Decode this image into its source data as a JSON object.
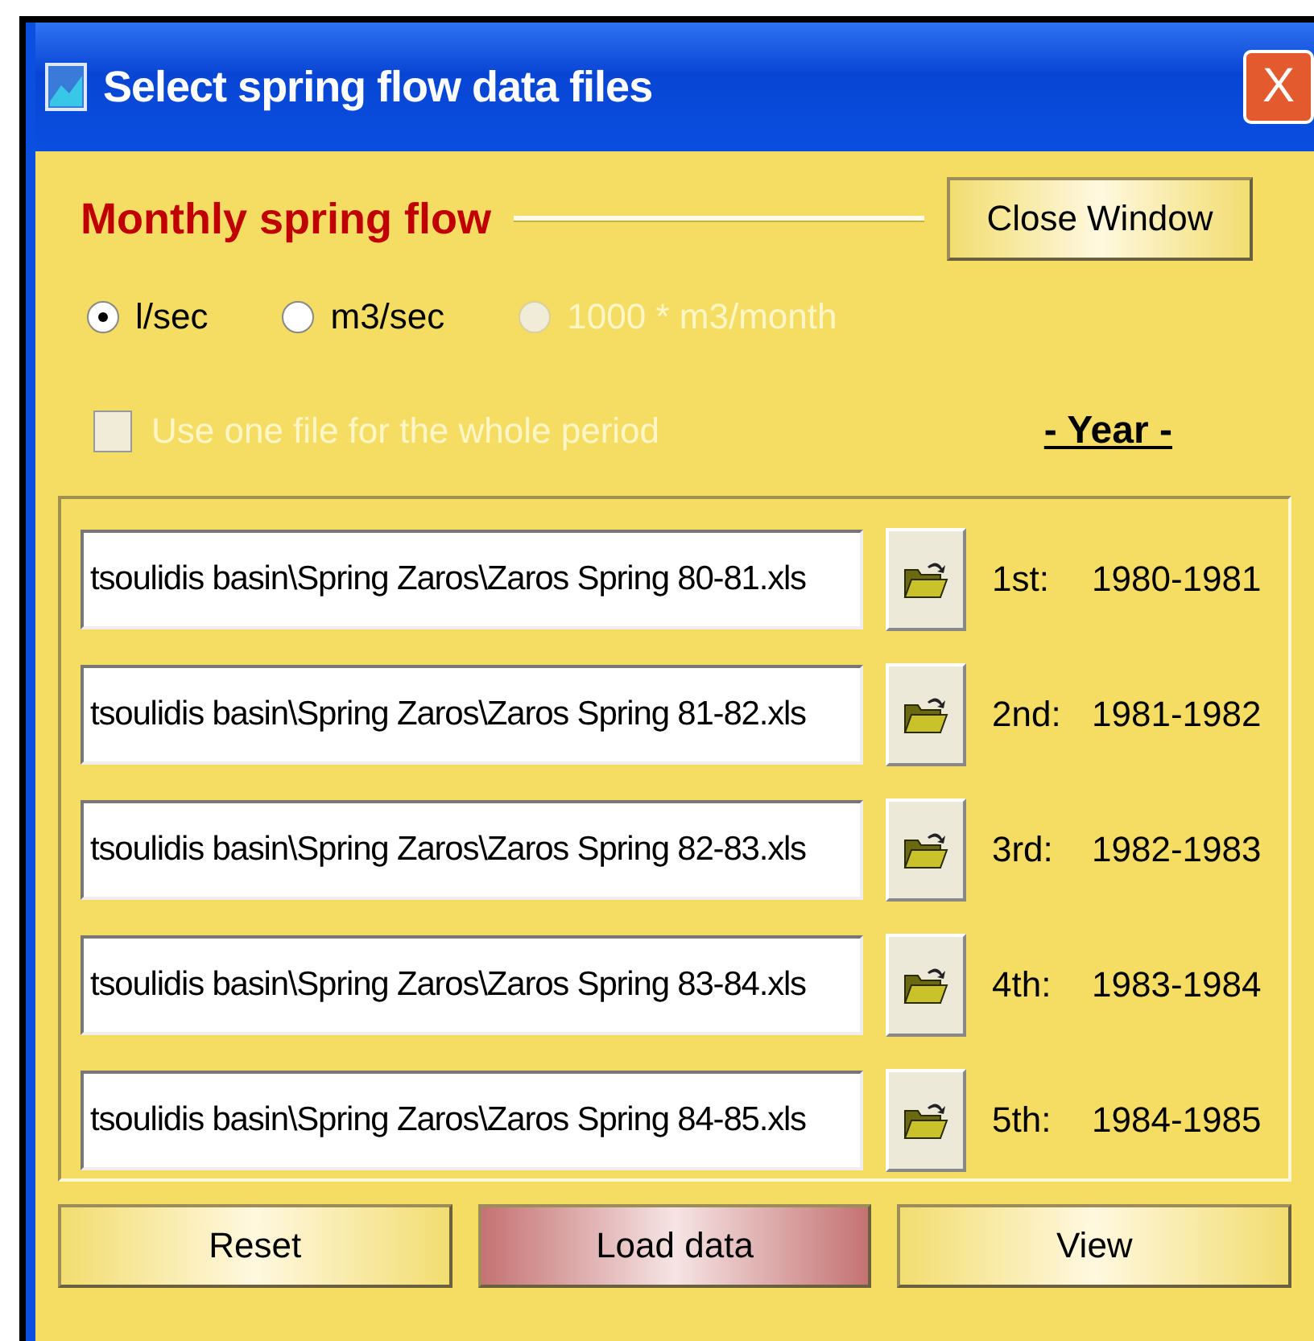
{
  "window": {
    "title": "Select spring flow data files",
    "close": "X"
  },
  "section": {
    "title": "Monthly spring flow"
  },
  "close_button": "Close Window",
  "units": [
    {
      "label": "l/sec",
      "selected": true,
      "disabled": false
    },
    {
      "label": "m3/sec",
      "selected": false,
      "disabled": false
    },
    {
      "label": "1000 * m3/month",
      "selected": false,
      "disabled": true
    }
  ],
  "one_file": {
    "label": "Use one file for the whole period",
    "checked": false,
    "disabled": true
  },
  "year_heading": "- Year -",
  "files": [
    {
      "path": "tsoulidis basin\\Spring Zaros\\Zaros Spring 80-81.xls",
      "ordinal": "1st:",
      "years": "1980-1981"
    },
    {
      "path": "tsoulidis basin\\Spring Zaros\\Zaros Spring 81-82.xls",
      "ordinal": "2nd:",
      "years": "1981-1982"
    },
    {
      "path": "tsoulidis basin\\Spring Zaros\\Zaros Spring 82-83.xls",
      "ordinal": "3rd:",
      "years": "1982-1983"
    },
    {
      "path": "tsoulidis basin\\Spring Zaros\\Zaros Spring 83-84.xls",
      "ordinal": "4th:",
      "years": "1983-1984"
    },
    {
      "path": "tsoulidis basin\\Spring Zaros\\Zaros Spring 84-85.xls",
      "ordinal": "5th:",
      "years": "1984-1985"
    }
  ],
  "buttons": [
    {
      "label": "Reset",
      "highlighted": false
    },
    {
      "label": "Load data",
      "highlighted": true
    },
    {
      "label": "View",
      "highlighted": false
    }
  ]
}
